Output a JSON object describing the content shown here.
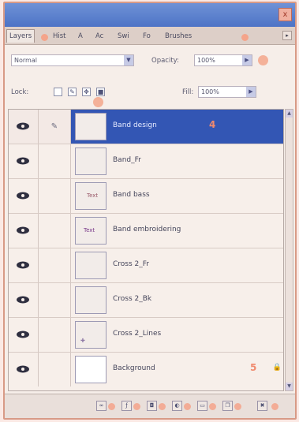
{
  "panel": {
    "tabs": [
      {
        "label": "Layers",
        "active": true
      },
      {
        "label": "Hist"
      },
      {
        "label": "A"
      },
      {
        "label": "Ac"
      },
      {
        "label": "Swi"
      },
      {
        "label": "Fo"
      },
      {
        "label": "Brushes"
      }
    ],
    "close_glyph": "x",
    "menu_glyph": "▸"
  },
  "options": {
    "blend_mode": "Normal",
    "opacity_label": "Opacity:",
    "opacity_value": "100%",
    "lock_label": "Lock:",
    "fill_label": "Fill:",
    "fill_value": "100%"
  },
  "layers": [
    {
      "name": "Band design",
      "selected": true,
      "annotation": "4"
    },
    {
      "name": "Band_Fr"
    },
    {
      "name": "Band bass",
      "thumb_label": "Text"
    },
    {
      "name": "Band embroidering",
      "thumb_label": "Text"
    },
    {
      "name": "Cross 2_Fr"
    },
    {
      "name": "Cross 2_Bk"
    },
    {
      "name": "Cross 2_Lines"
    },
    {
      "name": "Background",
      "locked_annotation": "5"
    }
  ],
  "colors": {
    "selected_row": "#3356b4",
    "title_bar": "#4d73c6",
    "annotation": "#f4a184"
  }
}
